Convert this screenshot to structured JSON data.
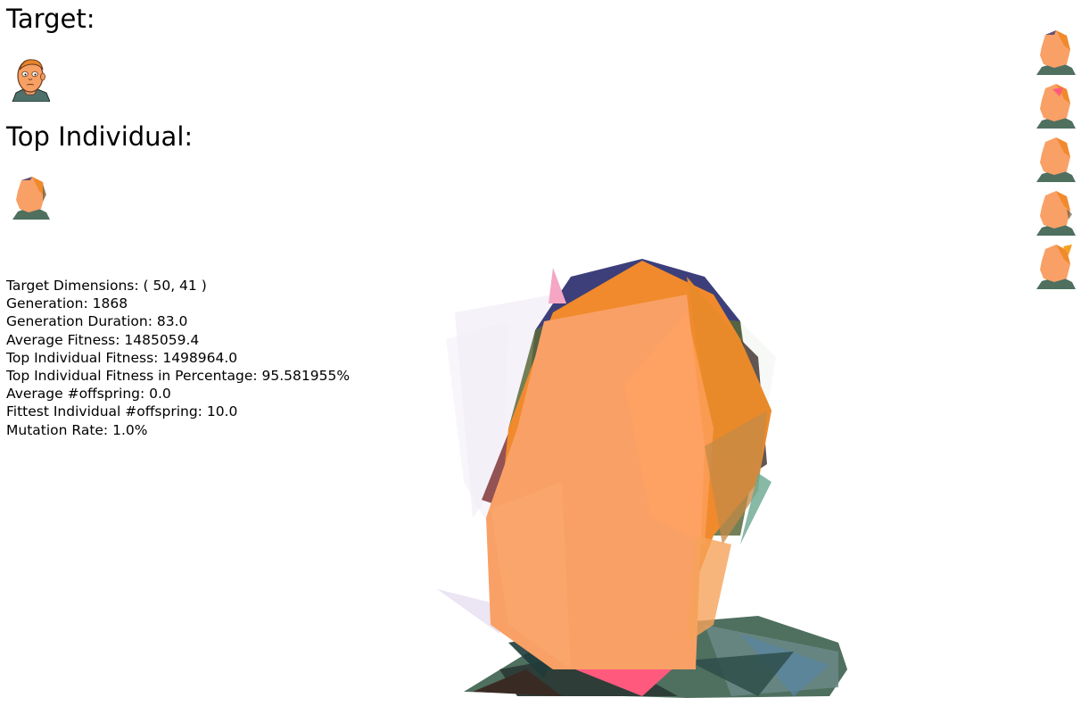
{
  "labels": {
    "target": "Target:",
    "top_individual": "Top Individual:"
  },
  "stats": [
    "Target Dimensions: ( 50, 41 )",
    "Generation: 1868",
    "Generation Duration: 83.0",
    "Average Fitness: 1485059.4",
    "Top Individual Fitness: 1498964.0",
    "Top Individual Fitness in Percentage: 95.581955%",
    "Average #offspring: 0.0",
    "Fittest Individual #offspring: 10.0",
    "Mutation Rate: 1.0%"
  ],
  "colors": {
    "skin": "#f9a066",
    "orange": "#f08a2c",
    "hair": "#e98a2a",
    "shirt": "#4f6f5f",
    "navy": "#3c3f7a",
    "pink": "#ff5a7e"
  },
  "images": {
    "target": "target-face-image",
    "top_individual": "top-individual-image",
    "render": "evolved-polygon-render",
    "population_count": 5
  }
}
